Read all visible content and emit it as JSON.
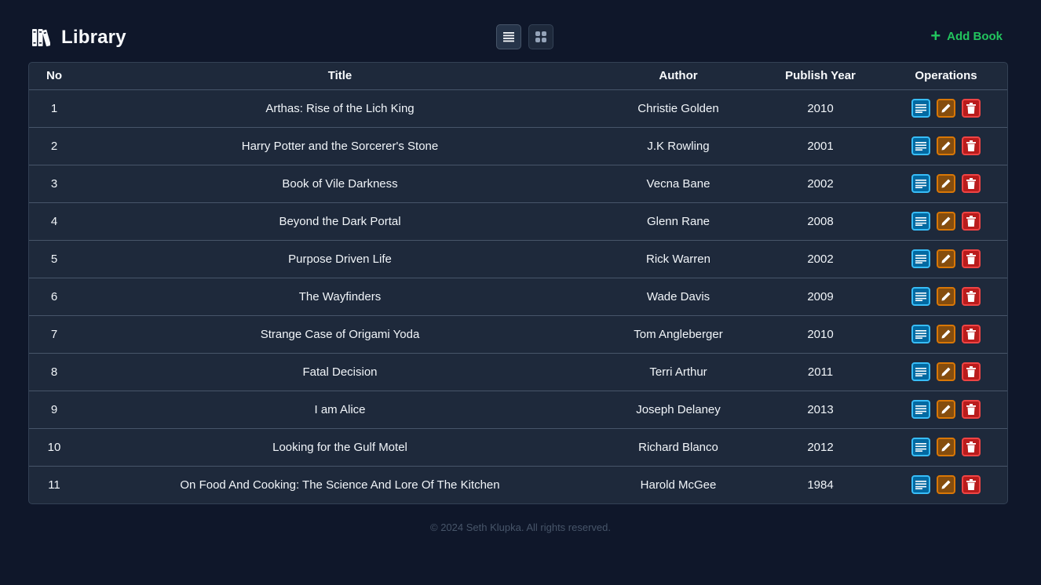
{
  "header": {
    "title": "Library",
    "add_label": "Add Book",
    "brand_icon": "books-icon",
    "view_modes": [
      "list-view-icon",
      "grid-view-icon"
    ]
  },
  "colors": {
    "background": "#0f172a",
    "surface": "#1e293b",
    "accent_green": "#22c55e",
    "info_blue": "#0ea5e9",
    "edit_amber": "#d97706",
    "delete_red": "#dc2626"
  },
  "table": {
    "columns": [
      "No",
      "Title",
      "Author",
      "Publish Year",
      "Operations"
    ],
    "rows": [
      {
        "no": "1",
        "title": "Arthas: Rise of the Lich King",
        "author": "Christie Golden",
        "year": "2010"
      },
      {
        "no": "2",
        "title": "Harry Potter and the Sorcerer's Stone",
        "author": "J.K Rowling",
        "year": "2001"
      },
      {
        "no": "3",
        "title": "Book of Vile Darkness",
        "author": "Vecna Bane",
        "year": "2002"
      },
      {
        "no": "4",
        "title": "Beyond the Dark Portal",
        "author": "Glenn Rane",
        "year": "2008"
      },
      {
        "no": "5",
        "title": "Purpose Driven Life",
        "author": "Rick Warren",
        "year": "2002"
      },
      {
        "no": "6",
        "title": "The Wayfinders",
        "author": "Wade Davis",
        "year": "2009"
      },
      {
        "no": "7",
        "title": "Strange Case of Origami Yoda",
        "author": "Tom Angleberger",
        "year": "2010"
      },
      {
        "no": "8",
        "title": "Fatal Decision",
        "author": "Terri Arthur",
        "year": "2011"
      },
      {
        "no": "9",
        "title": "I am Alice",
        "author": "Joseph Delaney",
        "year": "2013"
      },
      {
        "no": "10",
        "title": "Looking for the Gulf Motel",
        "author": "Richard Blanco",
        "year": "2012"
      },
      {
        "no": "11",
        "title": "On Food And Cooking: The Science And Lore Of The Kitchen",
        "author": "Harold McGee",
        "year": "1984"
      }
    ]
  },
  "footer": {
    "text": "© 2024 Seth Klupka. All rights reserved."
  }
}
